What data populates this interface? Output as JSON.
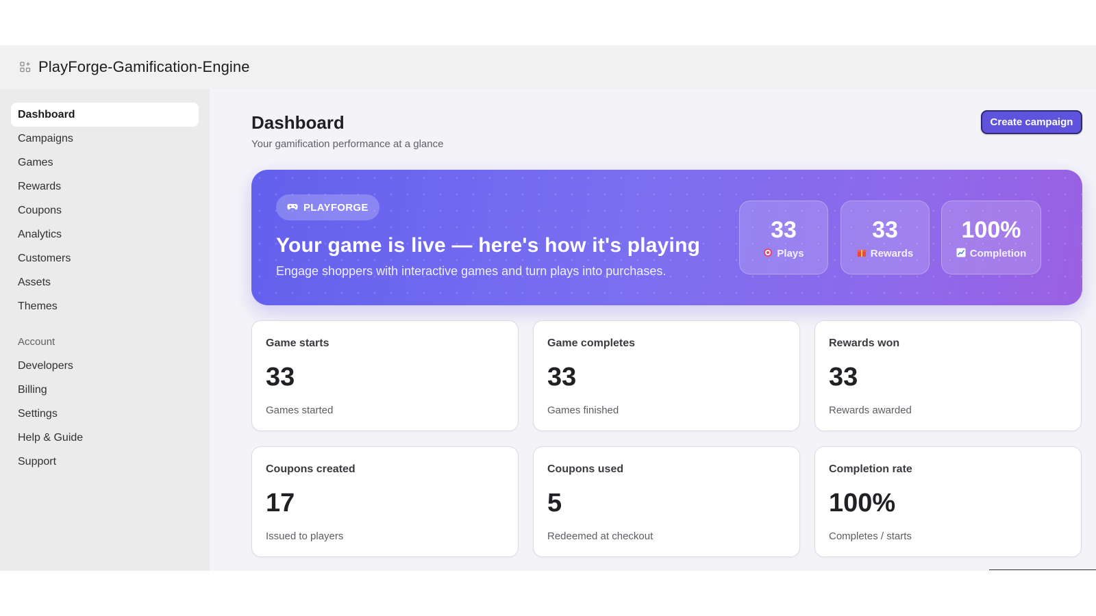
{
  "app": {
    "title": "PlayForge-Gamification-Engine",
    "icon": "apps-grid-icon"
  },
  "sidebar": {
    "items": [
      {
        "label": "Dashboard",
        "active": true
      },
      {
        "label": "Campaigns"
      },
      {
        "label": "Games"
      },
      {
        "label": "Rewards"
      },
      {
        "label": "Coupons"
      },
      {
        "label": "Analytics"
      },
      {
        "label": "Customers"
      },
      {
        "label": "Assets"
      },
      {
        "label": "Themes"
      }
    ],
    "section_label": "Account",
    "account_items": [
      {
        "label": "Developers"
      },
      {
        "label": "Billing"
      },
      {
        "label": "Settings"
      },
      {
        "label": "Help & Guide"
      },
      {
        "label": "Support"
      }
    ]
  },
  "header": {
    "title": "Dashboard",
    "subtitle": "Your gamification performance at a glance",
    "create_button": "Create campaign"
  },
  "hero": {
    "badge": "PLAYFORGE",
    "badge_icon": "gamepad-icon",
    "headline": "Your game is live — here's how it's playing",
    "text": "Engage shoppers with interactive games and turn plays into purchases.",
    "stats": [
      {
        "value": "33",
        "label": "Plays",
        "icon": "target-icon"
      },
      {
        "value": "33",
        "label": "Rewards",
        "icon": "gift-icon"
      },
      {
        "value": "100%",
        "label": "Completion",
        "icon": "chart-up-icon"
      }
    ]
  },
  "cards": [
    {
      "title": "Game starts",
      "value": "33",
      "desc": "Games started"
    },
    {
      "title": "Game completes",
      "value": "33",
      "desc": "Games finished"
    },
    {
      "title": "Rewards won",
      "value": "33",
      "desc": "Rewards awarded"
    },
    {
      "title": "Coupons created",
      "value": "17",
      "desc": "Issued to players"
    },
    {
      "title": "Coupons used",
      "value": "5",
      "desc": "Redeemed at checkout"
    },
    {
      "title": "Completion rate",
      "value": "100%",
      "desc": "Completes / starts"
    }
  ],
  "colors": {
    "accent": "#5e53dd",
    "hero_start": "#6360ee",
    "hero_end": "#9a60e2"
  }
}
